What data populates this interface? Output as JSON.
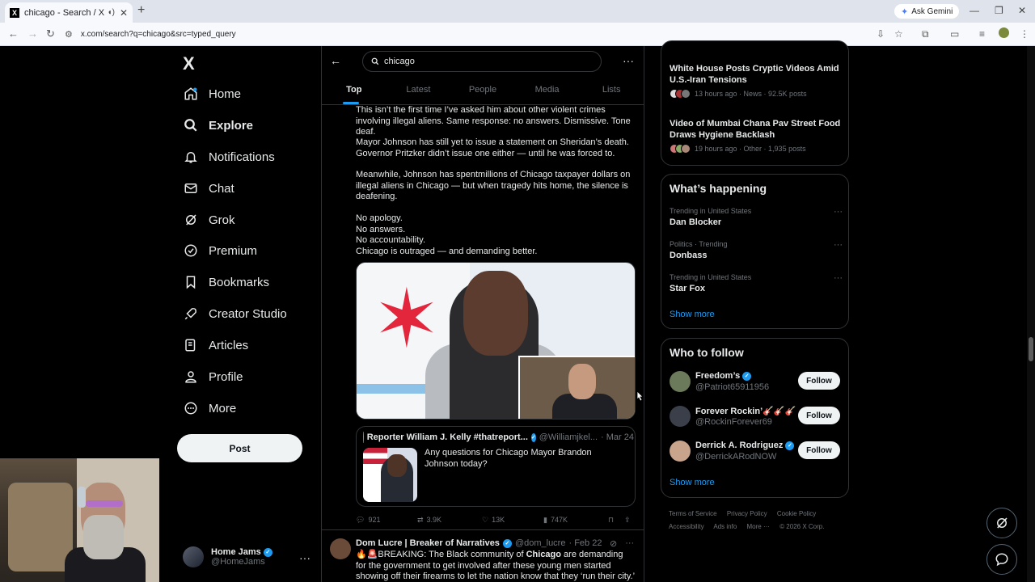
{
  "browser": {
    "tab_title": "chicago - Search / X",
    "tab_favicon": "X",
    "url": "x.com/search?q=chicago&src=typed_query",
    "gemini_label": "Ask Gemini"
  },
  "sidebar": {
    "logo": "X",
    "items": [
      {
        "label": "Home",
        "icon": "home-icon"
      },
      {
        "label": "Explore",
        "icon": "search-icon"
      },
      {
        "label": "Notifications",
        "icon": "bell-icon"
      },
      {
        "label": "Chat",
        "icon": "mail-icon"
      },
      {
        "label": "Grok",
        "icon": "grok-icon"
      },
      {
        "label": "Premium",
        "icon": "premium-icon"
      },
      {
        "label": "Bookmarks",
        "icon": "bookmark-icon"
      },
      {
        "label": "Creator Studio",
        "icon": "rocket-icon"
      },
      {
        "label": "Articles",
        "icon": "article-icon"
      },
      {
        "label": "Profile",
        "icon": "person-icon"
      },
      {
        "label": "More",
        "icon": "more-circle-icon"
      }
    ],
    "post_label": "Post",
    "account": {
      "name": "Home Jams",
      "handle": "@HomeJams"
    }
  },
  "search": {
    "query": "chicago",
    "tabs": [
      "Top",
      "Latest",
      "People",
      "Media",
      "Lists"
    ],
    "active_tab": "Top"
  },
  "tweet1": {
    "paragraphs": [
      "This isn’t the first time I’ve asked him about other violent crimes involving illegal aliens. Same response: no answers. Dismissive. Tone deaf.",
      "Mayor Johnson has still yet to issue a statement on Sheridan’s death. Governor Pritzker didn’t issue one either — until he was forced to.",
      "Meanwhile, Johnson has spentmillions of Chicago taxpayer dollars on illegal aliens in Chicago — but when tragedy hits home, the silence is deafening.",
      "No apology.\nNo answers.\nNo accountability.\nChicago is outraged — and demanding better."
    ],
    "quote": {
      "name": "Reporter William J. Kelly #thatreport...",
      "handle": "@Williamjkel...",
      "date": "· Mar 24",
      "text": "Any questions for Chicago Mayor Brandon Johnson today?"
    },
    "stats": {
      "replies": "921",
      "reposts": "3.9K",
      "likes": "13K",
      "views": "747K"
    }
  },
  "tweet2": {
    "name": "Dom Lucre | Breaker of Narratives",
    "handle": "@dom_lucre",
    "date": "· Feb 22",
    "text_prefix": "🔥🚨BREAKING: The Black community of ",
    "text_bold": "Chicago",
    "text_suffix": " are demanding for the government to get involved after these young men started showing off their firearms to let the nation know that they ‘run their city.’"
  },
  "news": [
    {
      "title": "White House Posts Cryptic Videos Amid U.S.-Iran Tensions",
      "meta": "13 hours ago · News · 92.5K posts"
    },
    {
      "title": "Video of Mumbai Chana Pav Street Food Draws Hygiene Backlash",
      "meta": "19 hours ago · Other · 1,935 posts"
    }
  ],
  "happening": {
    "title": "What’s happening",
    "trends": [
      {
        "context": "Trending in United States",
        "name": "Dan Blocker"
      },
      {
        "context": "Politics · Trending",
        "name": "Donbass"
      },
      {
        "context": "Trending in United States",
        "name": "Star Fox"
      }
    ],
    "show_more": "Show more"
  },
  "who_to_follow": {
    "title": "Who to follow",
    "accounts": [
      {
        "name": "Freedom’s",
        "handle": "@Patriot65911956",
        "avatar_color": "#6b7a5a"
      },
      {
        "name": "Forever Rockin’🎸🎸🎸",
        "handle": "@RockinForever69",
        "avatar_color": "#3b3f4a"
      },
      {
        "name": "Derrick A. Rodriguez",
        "handle": "@DerrickARodNOW",
        "avatar_color": "#c9a48c"
      }
    ],
    "follow_label": "Follow",
    "show_more": "Show more"
  },
  "footer": {
    "links": [
      "Terms of Service",
      "Privacy Policy",
      "Cookie Policy",
      "Accessibility",
      "Ads info",
      "More ···"
    ],
    "copyright": "© 2026 X Corp."
  },
  "colors": {
    "accent": "#1d9bf0",
    "background": "#000000",
    "text": "#e7e9ea",
    "muted": "#71767b"
  }
}
